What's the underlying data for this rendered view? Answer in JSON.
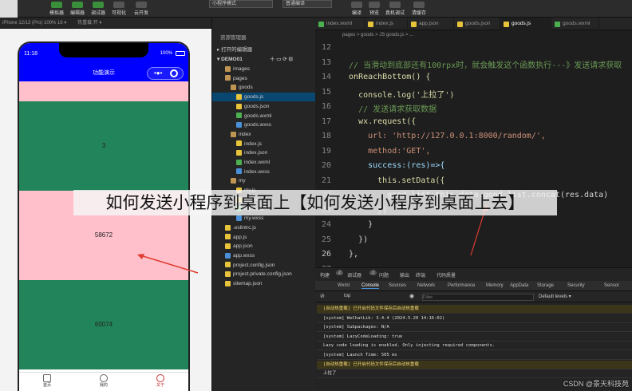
{
  "toolbar": {
    "buttons": [
      "模拟器",
      "编辑器",
      "调试器",
      "可视化",
      "云开发"
    ],
    "mode_select": "小程序模式",
    "compile_select": "普通编译",
    "right_buttons": [
      "编译",
      "预览",
      "真机调试",
      "清缓存"
    ]
  },
  "subbar": {
    "device": "iPhone 12/13 (Pro) 100% 16 ▾",
    "hot": "热重载 开 ▾"
  },
  "phone": {
    "time": "11:18",
    "battery": "100%",
    "nav_title": "功能演示",
    "blocks": [
      "3",
      "58672",
      "60074"
    ],
    "tabs": [
      "首页",
      "我的",
      "关于"
    ]
  },
  "explorer": {
    "title": "资源管理器",
    "open_editors": "打开的编辑器",
    "project": "DEMO01",
    "rows": [
      {
        "label": "images",
        "indent": 2,
        "type": "folder"
      },
      {
        "label": "pages",
        "indent": 2,
        "type": "folder"
      },
      {
        "label": "goods",
        "indent": 3,
        "type": "folder"
      },
      {
        "label": "goods.js",
        "indent": 4,
        "type": "js",
        "selected": true
      },
      {
        "label": "goods.json",
        "indent": 4,
        "type": "json"
      },
      {
        "label": "goods.wxml",
        "indent": 4,
        "type": "wxml"
      },
      {
        "label": "goods.wxss",
        "indent": 4,
        "type": "wxss"
      },
      {
        "label": "index",
        "indent": 3,
        "type": "folder"
      },
      {
        "label": "index.js",
        "indent": 4,
        "type": "js"
      },
      {
        "label": "index.json",
        "indent": 4,
        "type": "json"
      },
      {
        "label": "index.wxml",
        "indent": 4,
        "type": "wxml"
      },
      {
        "label": "index.wxss",
        "indent": 4,
        "type": "wxss"
      },
      {
        "label": "my",
        "indent": 3,
        "type": "folder"
      },
      {
        "label": "my.js",
        "indent": 4,
        "type": "js"
      },
      {
        "label": "my.json",
        "indent": 4,
        "type": "json"
      },
      {
        "label": "my.wxml",
        "indent": 4,
        "type": "wxml"
      },
      {
        "label": "my.wxss",
        "indent": 4,
        "type": "wxss"
      },
      {
        "label": ".eslintrc.js",
        "indent": 2,
        "type": "js"
      },
      {
        "label": "app.js",
        "indent": 2,
        "type": "js"
      },
      {
        "label": "app.json",
        "indent": 2,
        "type": "json"
      },
      {
        "label": "app.wxss",
        "indent": 2,
        "type": "wxss"
      },
      {
        "label": "project.config.json",
        "indent": 2,
        "type": "json"
      },
      {
        "label": "project.private.config.json",
        "indent": 2,
        "type": "json"
      },
      {
        "label": "sitemap.json",
        "indent": 2,
        "type": "json"
      }
    ]
  },
  "editor": {
    "tabs": [
      "index.wxml",
      "index.js",
      "app.json",
      "goods.json",
      "goods.js",
      "goods.wxml"
    ],
    "active_tab": "goods.js",
    "breadcrumb": "pages > goods > JS goods.js > ...",
    "line_numbers": [
      "12",
      "13",
      "14",
      "15",
      "16",
      "17",
      "18",
      "19",
      "20",
      "21",
      "22",
      "23",
      "24",
      "25",
      "26",
      "27"
    ],
    "lines": [
      "",
      "  // 当滑动到底部还有100rpx时，就会触发这个函数执行---》发送请求获取",
      "  onReachBottom() {",
      "    console.log('上拉了')",
      "    // 发送请求获取数据",
      "    wx.request({",
      "      url: 'http://127.0.0.1:8000/random/',",
      "      method:'GET',",
      "      success:(res)=>{",
      "        this.setData({",
      "          good_list:this.data.good_list.concat(res.data)",
      "        })",
      "      }",
      "    })",
      "  },",
      ""
    ]
  },
  "console": {
    "top_tabs": [
      "构建",
      "调试器",
      "问题",
      "输出",
      "终端",
      "代码质量"
    ],
    "counts": [
      "2",
      "2"
    ],
    "panels": [
      "Wxml",
      "Console",
      "Sources",
      "Network",
      "Performance",
      "Memory",
      "AppData",
      "Storage",
      "Security",
      "Sensor"
    ],
    "context": "top",
    "filter_placeholder": "Filter",
    "levels": "Default levels ▾",
    "logs": [
      {
        "text": "[自动热重载] 已开启代码文件保存后自动热重载",
        "warn": true
      },
      {
        "text": "[system] WeChatLib: 3.4.4 (2024.5.20 14:16:02)",
        "warn": false
      },
      {
        "text": "[system] Subpackages: N/A",
        "warn": false
      },
      {
        "text": "[system] LazyCodeLoading: true",
        "warn": false
      },
      {
        "text": "Lazy code loading is enabled. Only injecting required components.",
        "warn": false
      },
      {
        "text": "[system] Launch Time: 505 ms",
        "warn": false
      },
      {
        "text": "[自动热重载] 已开启代码文件保存后自动热重载",
        "warn": true
      },
      {
        "text": "上拉了",
        "warn": false
      }
    ]
  },
  "overlay": {
    "title": "如何发送小程序到桌面上【如何发送小程序到桌面上去】"
  },
  "watermark": "CSDN @景天科技苑",
  "colors": {
    "nav_blue": "#0000ff",
    "green_block": "#22845a",
    "pink_block": "#ffc0cb",
    "arrow": "#e03c31"
  }
}
